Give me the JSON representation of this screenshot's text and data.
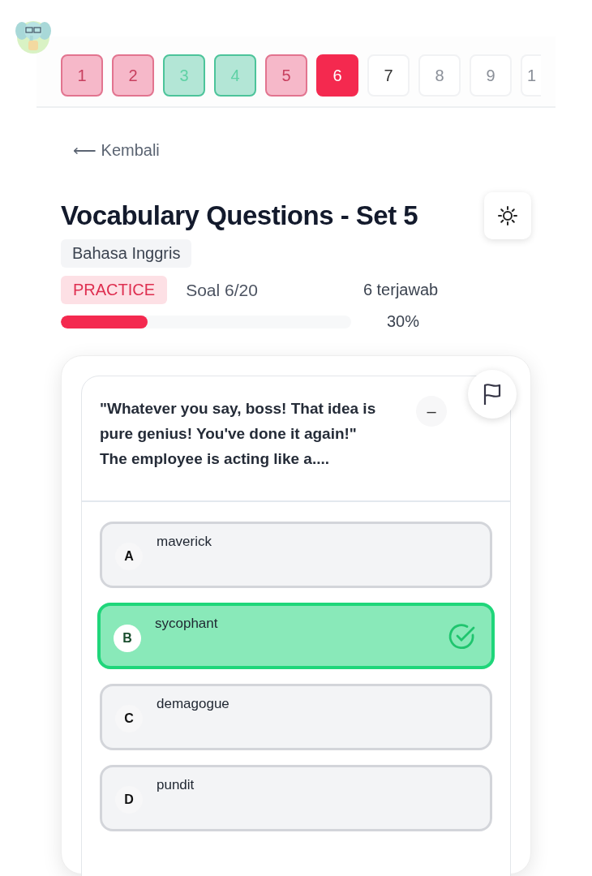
{
  "question_nav": [
    {
      "label": "1",
      "kind": "wrong"
    },
    {
      "label": "2",
      "kind": "wrong"
    },
    {
      "label": "3",
      "kind": "correct"
    },
    {
      "label": "4",
      "kind": "correct"
    },
    {
      "label": "5",
      "kind": "wrong"
    },
    {
      "label": "6",
      "kind": "current"
    },
    {
      "label": "7",
      "kind": "unanswered"
    },
    {
      "label": "8",
      "kind": "unanswered"
    },
    {
      "label": "9",
      "kind": "unanswered"
    },
    {
      "label": "1",
      "kind": "unanswered"
    }
  ],
  "back_link": {
    "arrow": "⟵",
    "label": "Kembali"
  },
  "title": "Vocabulary Questions - Set 5",
  "subject": "Bahasa Inggris",
  "mode": "PRACTICE",
  "counter": "Soal 6/20",
  "answered": "6 terjawab",
  "progress": {
    "level": 0.3,
    "reading": "30%"
  },
  "question": {
    "lines": [
      "\"Whatever you say, boss! That idea is pure genius! You've done it again!\"",
      "The employee is acting like a...."
    ],
    "zoom_out": "–"
  },
  "options": [
    {
      "letter": "A",
      "text": "maverick",
      "selected": false
    },
    {
      "letter": "B",
      "text": "sycophant",
      "selected": true
    },
    {
      "letter": "C",
      "text": "demagogue",
      "selected": false
    },
    {
      "letter": "D",
      "text": "pundit",
      "selected": false
    }
  ]
}
